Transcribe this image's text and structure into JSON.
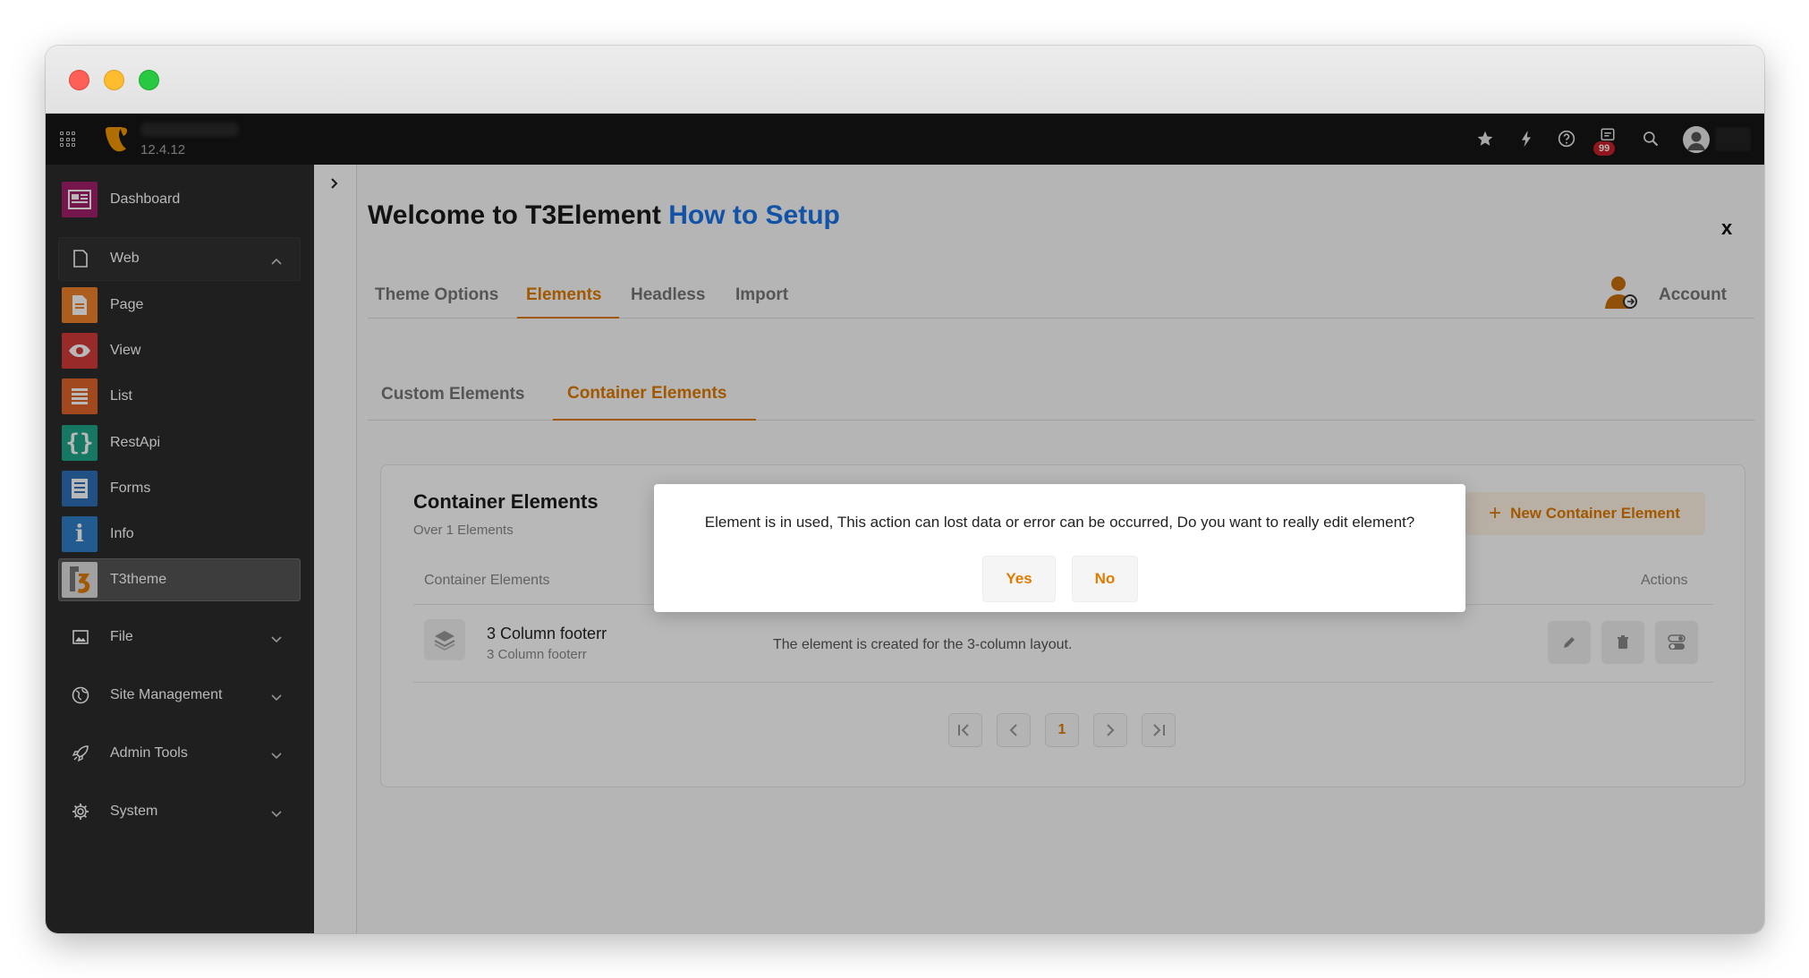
{
  "topbar": {
    "version": "12.4.12",
    "badge_count": "99"
  },
  "sidebar": {
    "items": [
      {
        "label": "Dashboard",
        "icon": "dashboard-icon",
        "color": "#a2216b"
      },
      {
        "label": "Web",
        "icon": "page-outline-icon"
      },
      {
        "label": "Page",
        "icon": "page-icon",
        "color": "#f0832a"
      },
      {
        "label": "View",
        "icon": "eye-icon",
        "color": "#d43b3b"
      },
      {
        "label": "List",
        "icon": "list-icon",
        "color": "#e0652b"
      },
      {
        "label": "RestApi",
        "icon": "braces-icon",
        "color": "#1fa58a"
      },
      {
        "label": "Forms",
        "icon": "form-icon",
        "color": "#2e6fb7"
      },
      {
        "label": "Info",
        "icon": "info-icon",
        "color": "#2e7fc6"
      },
      {
        "label": "T3theme",
        "icon": "t3theme-icon",
        "color": "#e0e0e0"
      },
      {
        "label": "File",
        "icon": "image-icon"
      },
      {
        "label": "Site Management",
        "icon": "globe-icon"
      },
      {
        "label": "Admin Tools",
        "icon": "rocket-icon"
      },
      {
        "label": "System",
        "icon": "gear-icon"
      }
    ]
  },
  "main": {
    "title": "Welcome to T3Element",
    "title_highlight": "How to Setup",
    "close_label": "x",
    "tabs": [
      "Theme Options",
      "Elements",
      "Headless",
      "Import"
    ],
    "account_label": "Account",
    "subtabs": [
      "Custom Elements",
      "Container Elements"
    ]
  },
  "card": {
    "title": "Container Elements",
    "subtitle": "Over 1 Elements",
    "new_button": "New Container Element",
    "col_name": "Container Elements",
    "col_actions": "Actions",
    "row": {
      "title": "3 Column footerr",
      "subtitle": "3 Column footerr",
      "description": "The element is created for the 3-column layout."
    },
    "pager_current": "1"
  },
  "dialog": {
    "message": "Element is in used, This action can lost data or error can be occurred, Do you want to really edit element?",
    "yes": "Yes",
    "no": "No"
  },
  "colors": {
    "accent": "#e07b00",
    "link": "#1a73e8",
    "topbar": "#151515",
    "sidebar": "#2b2b2b"
  }
}
